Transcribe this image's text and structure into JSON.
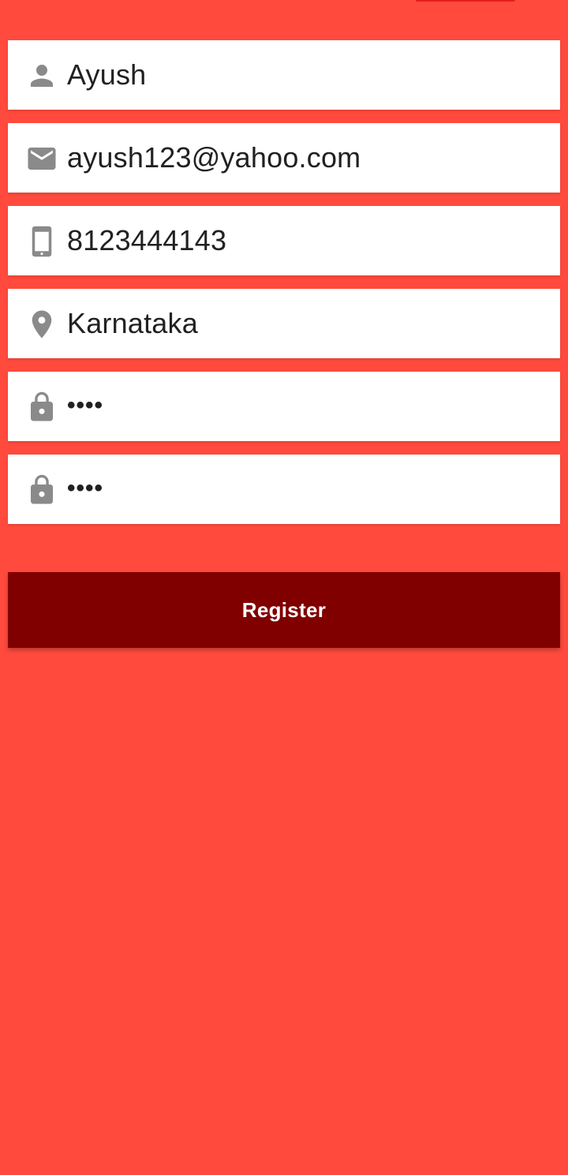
{
  "colors": {
    "background": "#FF4A3D",
    "accent": "#E81E1E",
    "button": "#800000",
    "icon": "#8A8A8A",
    "field_text": "#212121"
  },
  "form": {
    "name": {
      "icon": "person-icon",
      "value": "Ayush"
    },
    "email": {
      "icon": "email-icon",
      "value": "ayush123@yahoo.com"
    },
    "phone": {
      "icon": "smartphone-icon",
      "value": "8123444143"
    },
    "location": {
      "icon": "location-pin-icon",
      "value": "Karnataka"
    },
    "password": {
      "icon": "lock-icon",
      "value": "••••"
    },
    "confirm_password": {
      "icon": "lock-icon",
      "value": "••••"
    }
  },
  "register_button": {
    "label": "Register"
  }
}
